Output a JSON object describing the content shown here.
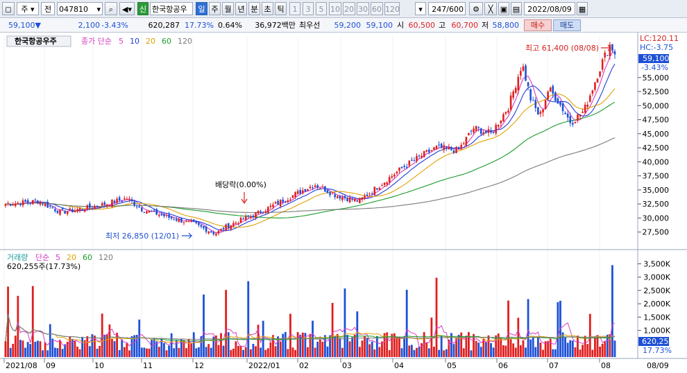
{
  "toolbar": {
    "mode": "주",
    "type": "전",
    "code": "047810",
    "signal": "신",
    "name": "한국항공우",
    "periods": [
      "일",
      "주",
      "월",
      "년",
      "분",
      "초",
      "틱"
    ],
    "active_period": "일",
    "intervals": [
      "1",
      "3",
      "5",
      "10",
      "20",
      "30",
      "60",
      "120"
    ],
    "count": "247",
    "count_max": "/600",
    "date": "2022/08/09"
  },
  "info": {
    "price": "59,100▼",
    "change": "2,100",
    "change_pct": "-3.43%",
    "volume": "620,287",
    "volume_pct": "17.73%",
    "turnover": "0.64%",
    "amount": "36,972백만",
    "best_label": "최우선",
    "best_ask": "59,200",
    "best_bid": "59,100",
    "open_label": "시",
    "open": "60,500",
    "high_label": "고",
    "high": "60,700",
    "low_label": "저",
    "low": "58,800",
    "buy_label": "매수",
    "sell_label": "매도"
  },
  "price_panel": {
    "title": "한국항공우주",
    "ma_label": "종가 단순",
    "ma_periods": [
      "5",
      "10",
      "20",
      "60",
      "120"
    ],
    "ma_colors": [
      "#d63cc4",
      "#1f3bd6",
      "#e0a100",
      "#1a9a2a",
      "#7a7a7a"
    ],
    "lc": "LC:120.11",
    "hc": "HC:-3.75",
    "last_price": "59,100",
    "last_change": "-3.43%",
    "high_annotation": "최고 61,400 (08/08)",
    "low_annotation": "최저 26,850 (12/01)",
    "dividend_annotation": "배당락(0.00%)",
    "y_ticks": [
      "55,000",
      "52,500",
      "50,000",
      "47,500",
      "45,000",
      "42,500",
      "40,000",
      "37,500",
      "35,000",
      "32,500",
      "30,000",
      "27,500"
    ]
  },
  "volume_panel": {
    "title": "거래량",
    "ma_label": "단순",
    "ma_periods": [
      "5",
      "20",
      "60",
      "120"
    ],
    "ma_colors": [
      "#d63cc4",
      "#e0a100",
      "#1a9a2a",
      "#7a7a7a"
    ],
    "value_label": "620,255주(17.73%)",
    "last_value": "620,255",
    "last_pct": "17.73%",
    "y_ticks": [
      "3,500K",
      "3,000K",
      "2,500K",
      "2,000K",
      "1,500K",
      "1,000K"
    ]
  },
  "x_axis": [
    "2021/08",
    "09",
    "10",
    "11",
    "12",
    "2022/01",
    "02",
    "03",
    "04",
    "05",
    "06",
    "07",
    "08",
    "08/09"
  ],
  "colors": {
    "up": "#e01e1e",
    "down": "#1e50d6",
    "accent": "#2f6fd6"
  },
  "chart_data": {
    "type": "candlestick",
    "y_range": [
      25000,
      62500
    ],
    "volume_range": [
      0,
      3800000
    ],
    "monthly_close": [
      {
        "month": "2021/08",
        "value": 32500
      },
      {
        "month": "09",
        "value": 32000
      },
      {
        "month": "10",
        "value": 31500
      },
      {
        "month": "11",
        "value": 29500
      },
      {
        "month": "12",
        "value": 31000
      },
      {
        "month": "2022/01",
        "value": 35500
      },
      {
        "month": "02",
        "value": 33500
      },
      {
        "month": "03",
        "value": 41000
      },
      {
        "month": "04",
        "value": 42500
      },
      {
        "month": "05",
        "value": 46500
      },
      {
        "month": "06",
        "value": 52000
      },
      {
        "month": "07",
        "value": 49500
      },
      {
        "month": "08",
        "value": 59100
      }
    ],
    "high": 61400,
    "high_date": "08/08",
    "low": 26850,
    "low_date": "12/01"
  }
}
